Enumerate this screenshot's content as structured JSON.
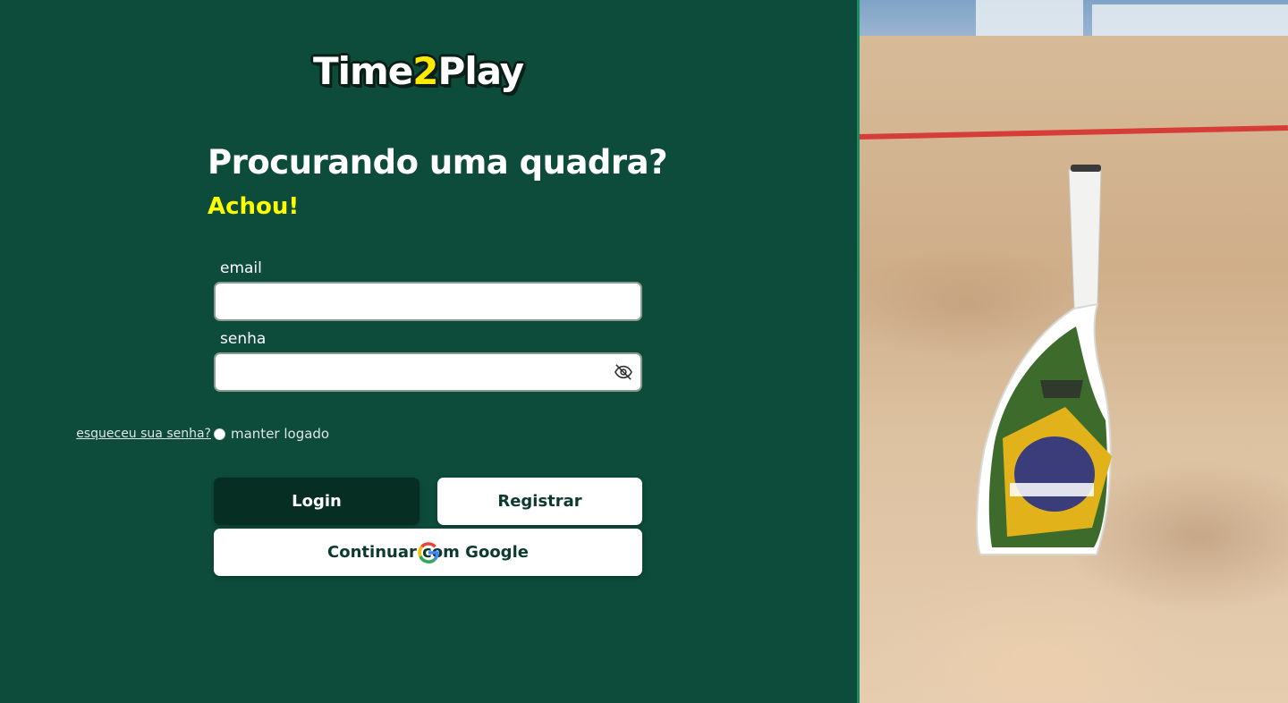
{
  "brand": {
    "logo_part1": "Time",
    "logo_accent": "2",
    "logo_part2": "Play"
  },
  "hero": {
    "headline": "Procurando uma quadra?",
    "subheadline": "Achou!"
  },
  "form": {
    "email_label": "email",
    "email_value": "",
    "password_label": "senha",
    "password_value": "",
    "remember_label": "manter logado",
    "forgot_link": "esqueceu sua senha?"
  },
  "buttons": {
    "login": "Login",
    "register": "Registrar",
    "google": "Continuar com Google"
  },
  "colors": {
    "background": "#0d4b3b",
    "login_button": "#062e23",
    "accent_yellow": "#ffff00",
    "divider": "#1c8a5e"
  },
  "icons": {
    "password_toggle": "eye-off-icon",
    "google": "google-icon"
  }
}
